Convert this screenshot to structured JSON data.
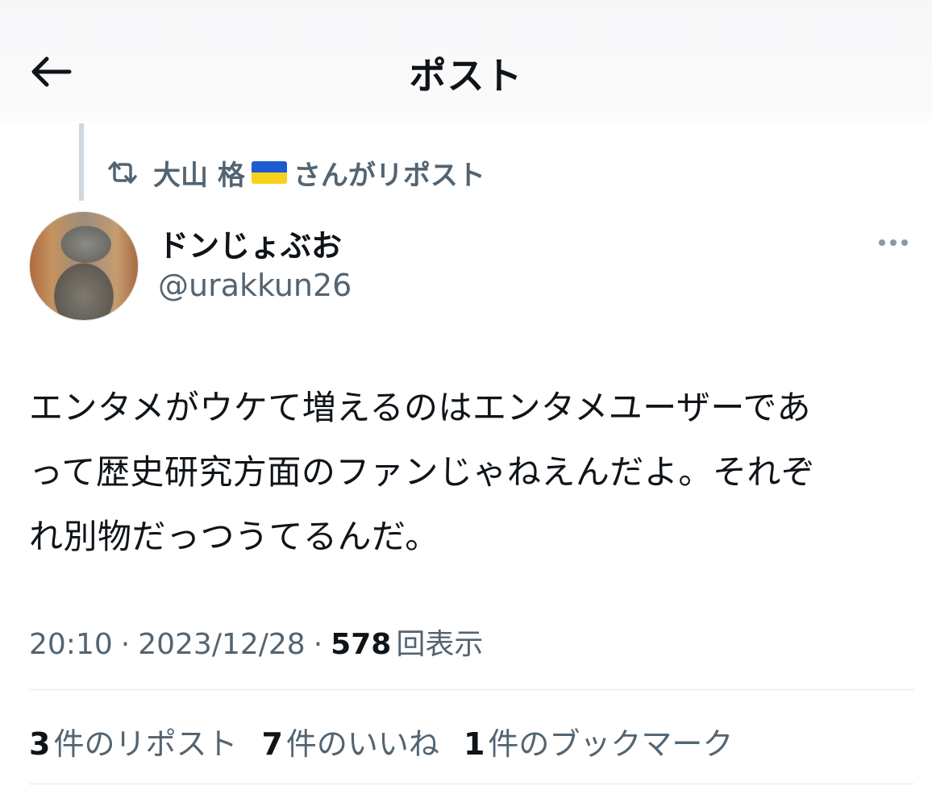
{
  "header": {
    "title": "ポスト"
  },
  "repost": {
    "user": "大山 格",
    "suffix": "さんがリポスト"
  },
  "author": {
    "display_name": "ドンじょぶお",
    "handle": "@urakkun26"
  },
  "tweet": {
    "lines": [
      "エンタメがウケて増えるのはエンタメユーザーであ",
      "って歴史研究方面のファンじゃねえんだよ。それぞ",
      "れ別物だっつうてるんだ。"
    ]
  },
  "meta": {
    "time": "20:10",
    "date": "2023/12/28",
    "views_count": "578",
    "views_label": "回表示",
    "separator": "·"
  },
  "stats": {
    "reposts": {
      "count": "3",
      "label": "件のリポスト"
    },
    "likes": {
      "count": "7",
      "label": "件のいいね"
    },
    "bookmarks": {
      "count": "1",
      "label": "件のブックマーク"
    }
  },
  "colors": {
    "text": "#0f1419",
    "secondary": "#536471",
    "divider": "#e1e8ed",
    "flag_blue": "#1f5bd0",
    "flag_yellow": "#f7d21c"
  },
  "icons": {
    "back": "arrow-left-icon",
    "repost": "repost-icon",
    "more": "more-horizontal-icon"
  }
}
